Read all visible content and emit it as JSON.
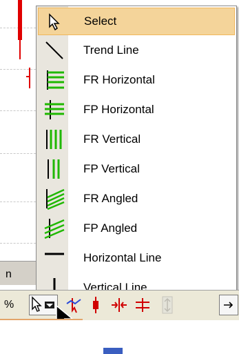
{
  "menu": {
    "items": [
      {
        "label": "Select",
        "icon": "select-arrow-icon",
        "selected": true
      },
      {
        "label": "Trend Line",
        "icon": "trend-line-icon",
        "selected": false
      },
      {
        "label": "FR Horizontal",
        "icon": "fr-horizontal-icon",
        "selected": false
      },
      {
        "label": "FP Horizontal",
        "icon": "fp-horizontal-icon",
        "selected": false
      },
      {
        "label": "FR Vertical",
        "icon": "fr-vertical-icon",
        "selected": false
      },
      {
        "label": "FP Vertical",
        "icon": "fp-vertical-icon",
        "selected": false
      },
      {
        "label": "FR Angled",
        "icon": "fr-angled-icon",
        "selected": false
      },
      {
        "label": "FP Angled",
        "icon": "fp-angled-icon",
        "selected": false
      },
      {
        "label": "Horizontal Line",
        "icon": "horizontal-line-icon",
        "selected": false
      },
      {
        "label": "Vertical Line",
        "icon": "vertical-line-icon",
        "selected": false
      }
    ]
  },
  "side_tab": {
    "label": "n"
  },
  "status": {
    "percent_label": "%"
  },
  "colors": {
    "highlight": "#f4d49a",
    "highlight_border": "#f0b65a",
    "gutter": "#e9e6de",
    "candle_red": "#e00000",
    "fib_green": "#1fb800"
  }
}
